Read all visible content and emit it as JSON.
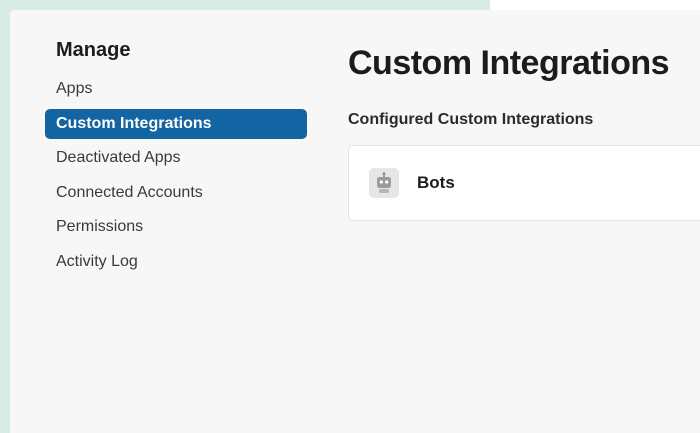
{
  "sidebar": {
    "heading": "Manage",
    "items": [
      {
        "label": "Apps",
        "active": false
      },
      {
        "label": "Custom Integrations",
        "active": true
      },
      {
        "label": "Deactivated Apps",
        "active": false
      },
      {
        "label": "Connected Accounts",
        "active": false
      },
      {
        "label": "Permissions",
        "active": false
      },
      {
        "label": "Activity Log",
        "active": false
      }
    ]
  },
  "main": {
    "title": "Custom Integrations",
    "section_label": "Configured Custom Integrations",
    "integrations": [
      {
        "label": "Bots",
        "icon": "robot-icon"
      }
    ]
  },
  "colors": {
    "accent": "#1264a3",
    "panel_background": "#f7f7f7",
    "page_background": "#d6ece4"
  }
}
